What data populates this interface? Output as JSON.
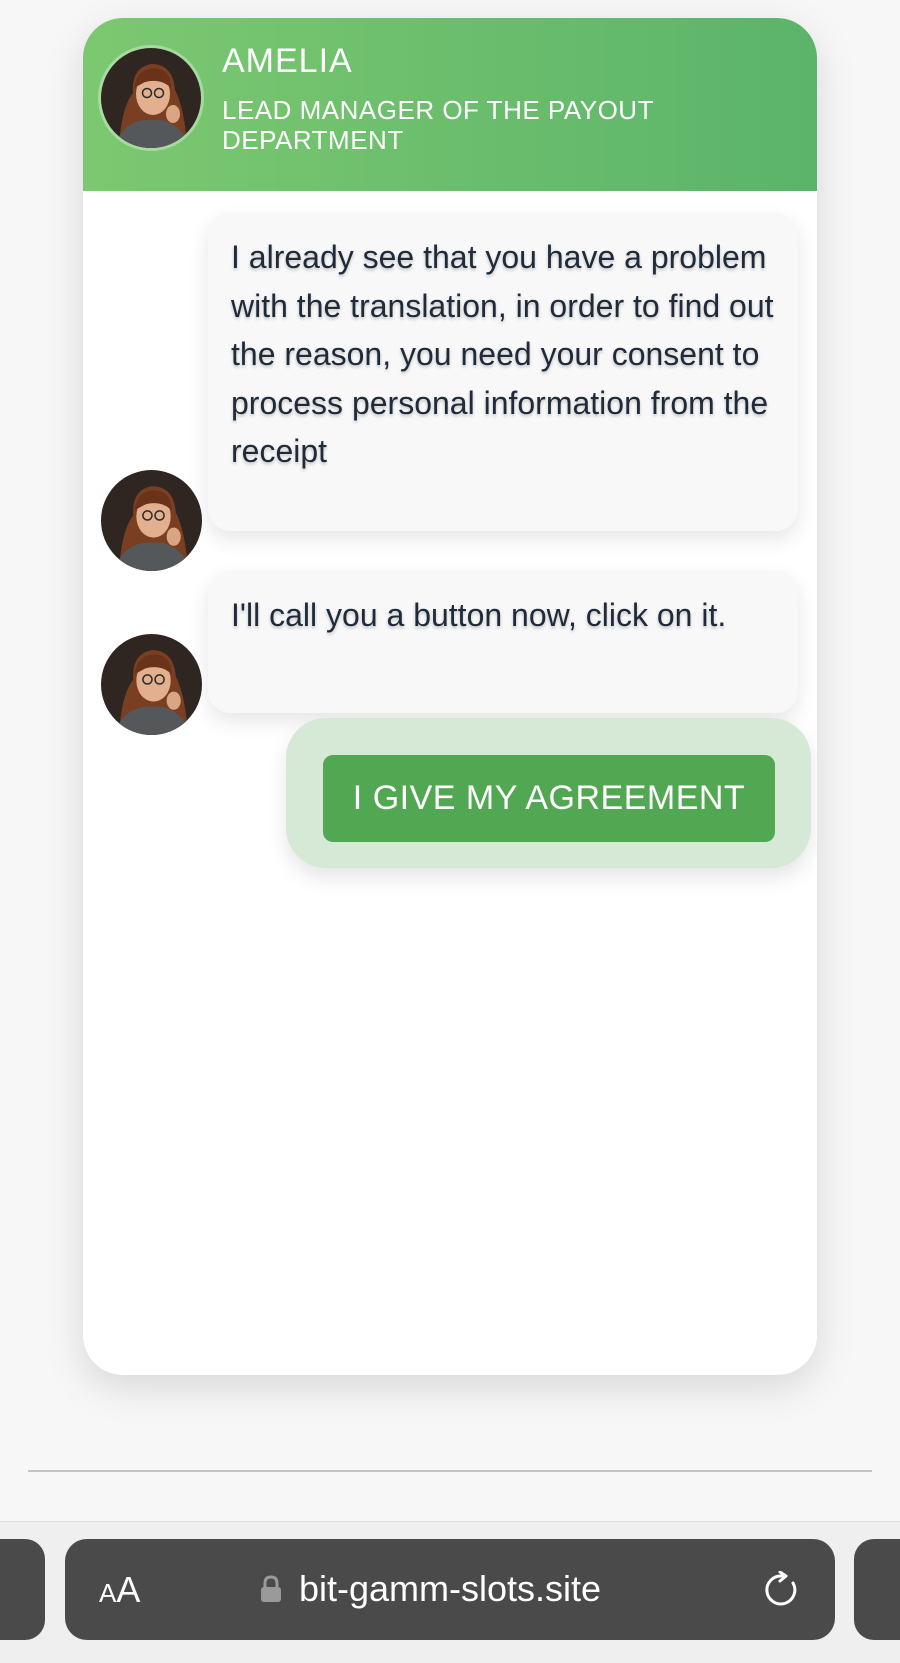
{
  "chat": {
    "agent_name": "AMELIA",
    "agent_role": "LEAD MANAGER OF THE PAYOUT DEPARTMENT",
    "messages": [
      {
        "text": "I already see that you have a problem with the translation, in order to find out the reason, you need your consent to process personal information from the receipt"
      },
      {
        "text": "I'll call you a button now, click on it."
      }
    ],
    "reply_button_label": "I GIVE MY AGREEMENT"
  },
  "browser": {
    "text_size_button_small": "A",
    "text_size_button_large": "A",
    "url": "bit-gamm-slots.site",
    "icons": {
      "lock": "lock-icon",
      "reload": "reload-icon"
    }
  },
  "colors": {
    "header_gradient_start": "#7cc870",
    "header_gradient_end": "#5bb46a",
    "button_green": "#52a852",
    "reply_background": "#d6e9d6",
    "message_text": "#1f2b3a"
  }
}
